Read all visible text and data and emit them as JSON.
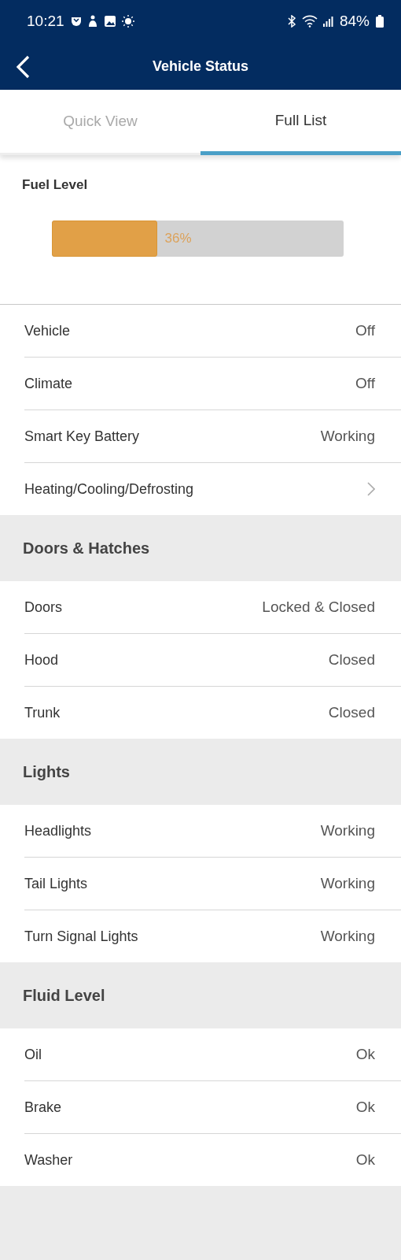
{
  "status_bar": {
    "time": "10:21",
    "battery": "84%"
  },
  "app_bar": {
    "title": "Vehicle Status"
  },
  "tabs": [
    {
      "label": "Quick View",
      "selected": false
    },
    {
      "label": "Full List",
      "selected": true
    }
  ],
  "fuel": {
    "title": "Fuel Level",
    "level": 0.36,
    "reading": "36%"
  },
  "sections": [
    {
      "rows": [
        {
          "kind": "value",
          "label": "Vehicle",
          "value": "Off"
        },
        {
          "kind": "value",
          "label": "Climate",
          "value": "Off"
        },
        {
          "kind": "value",
          "label": "Smart Key Battery",
          "value": "Working"
        },
        {
          "kind": "link",
          "label": "Heating/Cooling/Defrosting"
        }
      ]
    },
    {
      "title": "Doors & Hatches",
      "rows": [
        {
          "kind": "value",
          "label": "Doors",
          "value": "Locked & Closed"
        },
        {
          "kind": "value",
          "label": "Hood",
          "value": "Closed"
        },
        {
          "kind": "value",
          "label": "Trunk",
          "value": "Closed"
        }
      ]
    },
    {
      "title": "Lights",
      "rows": [
        {
          "kind": "value",
          "label": "Headlights",
          "value": "Working"
        },
        {
          "kind": "value",
          "label": "Tail Lights",
          "value": "Working"
        },
        {
          "kind": "value",
          "label": "Turn Signal Lights",
          "value": "Working"
        }
      ]
    },
    {
      "title": "Fluid Level",
      "rows": [
        {
          "kind": "value",
          "label": "Oil",
          "value": "Ok"
        },
        {
          "kind": "value",
          "label": "Brake",
          "value": "Ok"
        },
        {
          "kind": "value",
          "label": "Washer",
          "value": "Ok"
        }
      ]
    }
  ]
}
